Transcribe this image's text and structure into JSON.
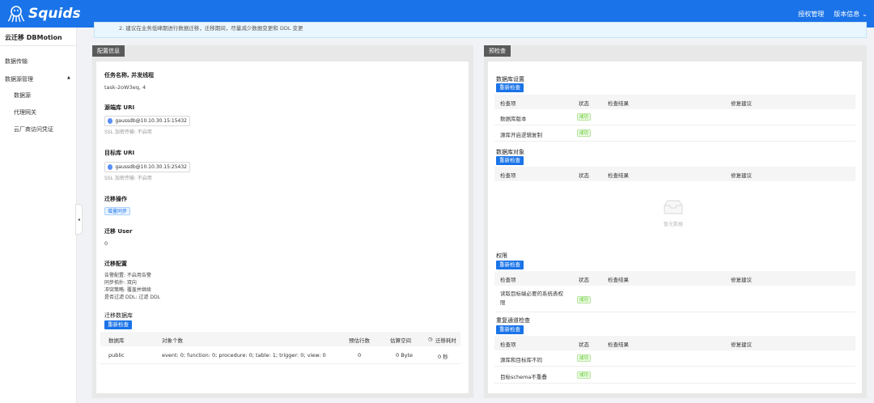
{
  "header": {
    "brand": "Squids",
    "menu": [
      "授权管理",
      "版本信息"
    ]
  },
  "sidebar": {
    "title": "云迁移 DBMotion",
    "items": [
      "数据传输",
      "数据源管理",
      "数据源",
      "代理网关",
      "云厂商访问凭证"
    ]
  },
  "notice": "2. 建议在业务低峰期进行数据迁移，迁移期间，尽量减少数据变更和 DDL 变更",
  "config": {
    "tag": "配置信息",
    "task_label": "任务名称, 并发线程",
    "task_value": "task-2oW3eq, 4",
    "src_label": "源端库 URI",
    "src_uri": "gaussdb@10.10.30.15:15432",
    "src_ssl": "SSL 加密传输: 不启用",
    "dst_label": "目标库 URI",
    "dst_uri": "gaussdb@10.10.30.15:25432",
    "dst_ssl": "SSL 加密传输: 不启用",
    "op_label": "迁移操作",
    "op_tag": "增量同步",
    "user_label": "迁移 User",
    "user_value": "0",
    "cfg_label": "迁移配置",
    "cfg_lines": [
      "告警配置: 不启用告警",
      "同步拓扑: 双向",
      "冲突策略: 覆盖并继续",
      "是否过滤 DDL: 过滤 DDL"
    ],
    "db_section": "迁移数据库",
    "recheck": "重新检查",
    "table_headers": [
      "数据库",
      "对象个数",
      "预估行数",
      "估算空间",
      "迁移耗时"
    ],
    "rows": [
      {
        "db": "public",
        "objects": "event: 0; function: 0; procedure: 0; table: 1; trigger: 0; view: 0",
        "rows": "0",
        "space": "0 Byte",
        "time": "0 秒"
      }
    ]
  },
  "precheck": {
    "tag": "预检查",
    "headers": [
      "检查项",
      "状态",
      "检查结果",
      "修复建议"
    ],
    "recheck": "重新检查",
    "sections": [
      {
        "title": "数据库设置",
        "items": [
          {
            "name": "数据库版本",
            "status": "成功"
          },
          {
            "name": "源库开启逻辑复制",
            "status": "成功"
          }
        ]
      },
      {
        "title": "数据库对象",
        "empty": "暂无数据"
      },
      {
        "title": "权限",
        "items": [
          {
            "name": "读取目标端必要的系统表权限",
            "status": "成功"
          }
        ]
      },
      {
        "title": "重复通道检查",
        "items": [
          {
            "name": "源库和目标库不同",
            "status": "成功"
          },
          {
            "name": "目标schema不重叠",
            "status": "成功"
          }
        ]
      }
    ]
  }
}
